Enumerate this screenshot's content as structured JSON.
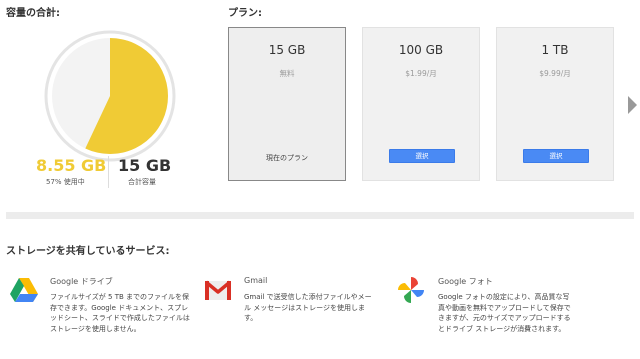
{
  "storage": {
    "title": "容量の合計:",
    "used": "8.55 GB",
    "used_label": "57% 使用中",
    "used_fraction": 0.57,
    "total": "15 GB",
    "total_label": "合計容量",
    "colors": {
      "used": "#f0cb35",
      "free": "#f3f3f3",
      "ring": "#e4e4e4"
    }
  },
  "plans": {
    "title": "プラン:",
    "items": [
      {
        "size": "15 GB",
        "price": "無料",
        "current_label": "現在のプラン"
      },
      {
        "size": "100 GB",
        "price": "$1.99/月",
        "button": "選択"
      },
      {
        "size": "1 TB",
        "price": "$9.99/月",
        "button": "選択"
      }
    ],
    "next_icon": "chevron-right-icon"
  },
  "services": {
    "title": "ストレージを共有しているサービス:",
    "items": [
      {
        "name": "Google ドライブ",
        "icon": "google-drive-icon",
        "desc": "ファイルサイズが 5 TB までのファイルを保存できます。Google ドキュメント、スプレッドシート、スライドで作成したファイルはストレージを使用しません。"
      },
      {
        "name": "Gmail",
        "icon": "gmail-icon",
        "desc": "Gmail で送受信した添付ファイルやメール メッセージはストレージを使用します。"
      },
      {
        "name": "Google フォト",
        "icon": "google-photos-icon",
        "desc": "Google フォトの設定により、高品質な写真や動画を無料でアップロードして保存できますが、元のサイズでアップロードするとドライブ ストレージが消費されます。"
      }
    ]
  }
}
